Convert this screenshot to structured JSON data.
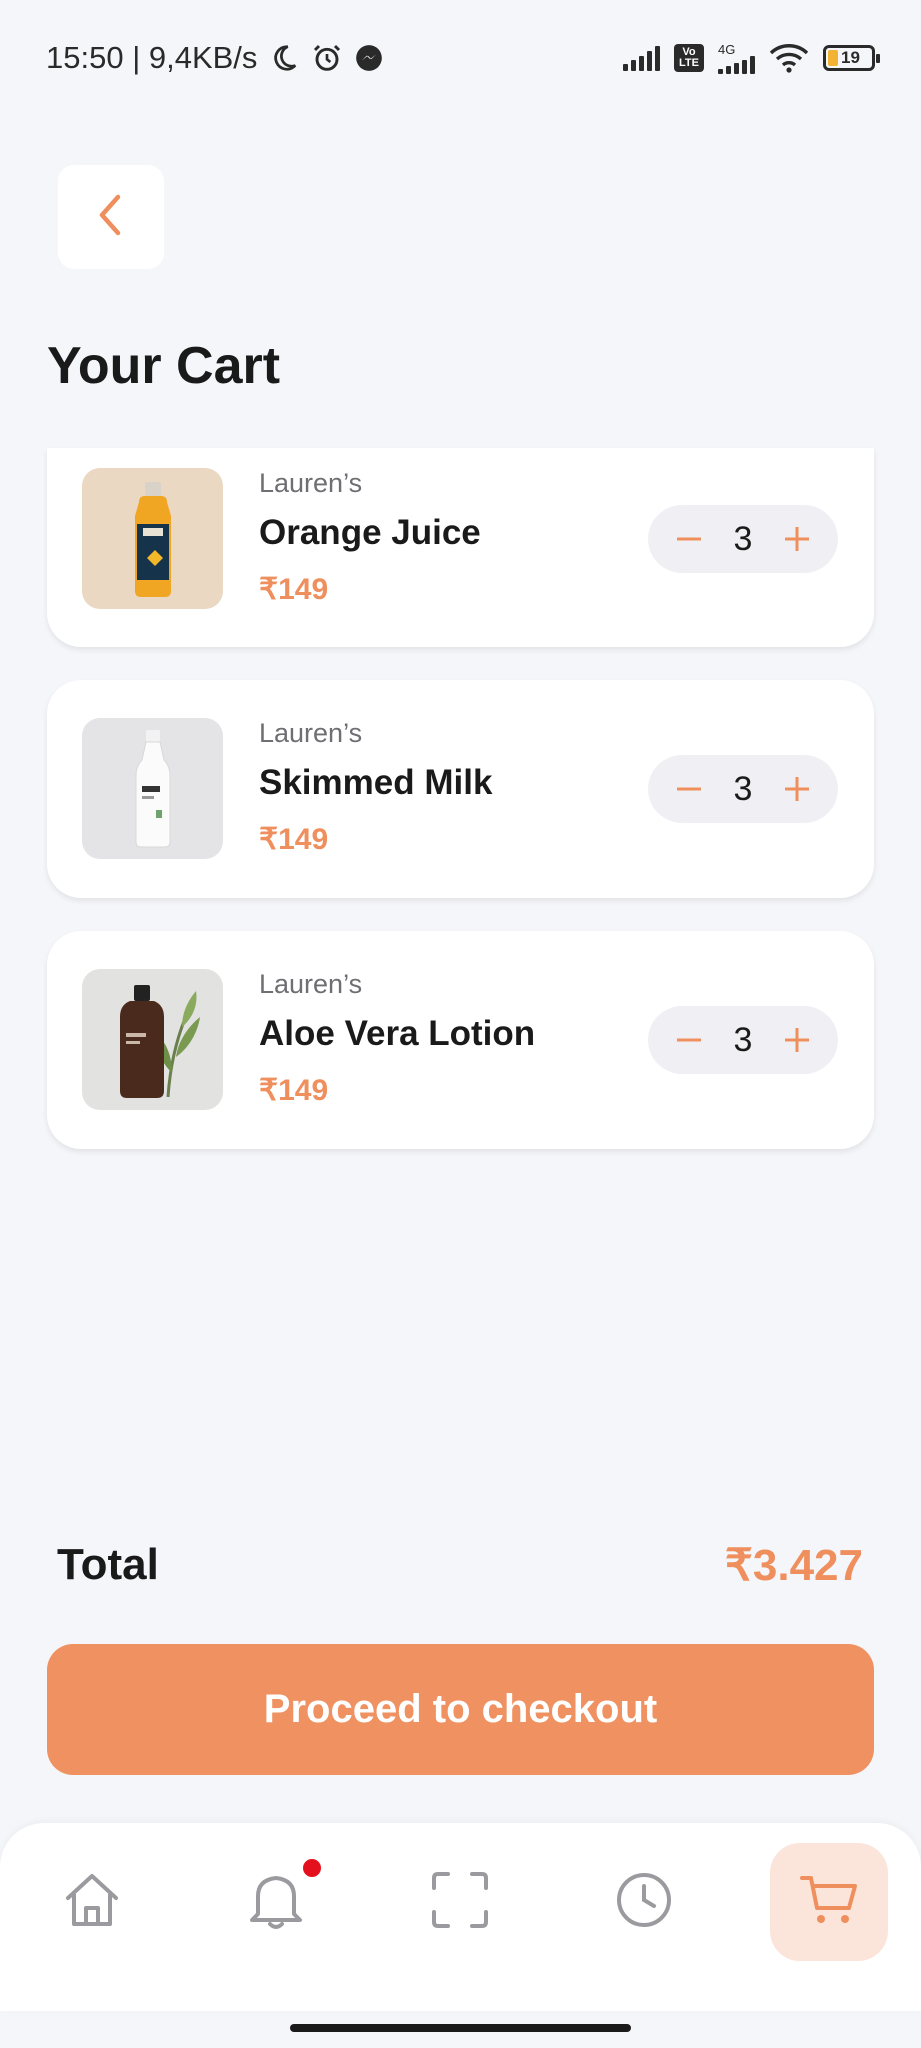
{
  "status_bar": {
    "time_speed": "15:50 | 9,4KB/s",
    "volte": "Vo LTE",
    "network": "4G",
    "battery": "19"
  },
  "header": {
    "title": "Your Cart"
  },
  "cart": {
    "items": [
      {
        "brand": "Lauren’s",
        "name": "Orange Juice",
        "price": "₹149",
        "qty": "3",
        "thumb_icon": "orange-juice-bottle"
      },
      {
        "brand": "Lauren’s",
        "name": "Skimmed Milk",
        "price": "₹149",
        "qty": "3",
        "thumb_icon": "milk-bottle"
      },
      {
        "brand": "Lauren’s",
        "name": "Aloe Vera Lotion",
        "price": "₹149",
        "qty": "3",
        "thumb_icon": "lotion-bottle"
      }
    ]
  },
  "summary": {
    "total_label": "Total",
    "total_value": "₹3.427"
  },
  "checkout": {
    "label": "Proceed to checkout"
  },
  "nav": {
    "items": [
      "home-icon",
      "bell-icon",
      "scan-icon",
      "history-icon",
      "cart-icon"
    ],
    "active": "cart-icon"
  },
  "colors": {
    "accent": "#ef9160",
    "price": "#ef8f5e",
    "background": "#f5f6fa",
    "badge": "#e5101e"
  }
}
